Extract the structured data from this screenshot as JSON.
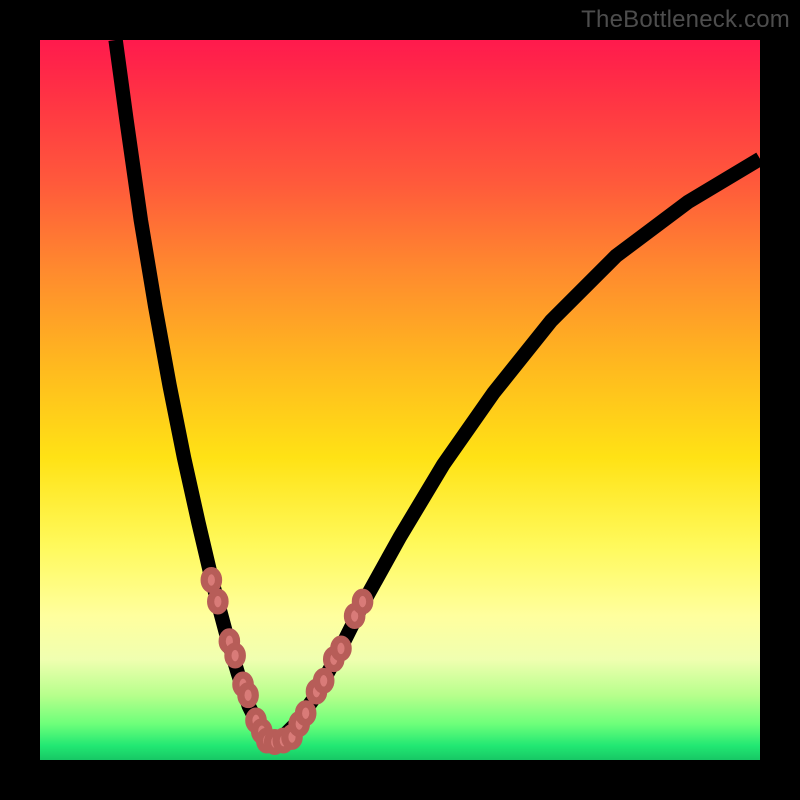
{
  "watermark": "TheBottleneck.com",
  "colors": {
    "frame_background": "#000000",
    "gradient_top": "#ff1a4d",
    "gradient_bottom": "#17c765",
    "curve_stroke": "#000000",
    "datapoint_fill": "#d97b78",
    "datapoint_stroke": "#b75d58",
    "watermark_text": "#4d4d4d"
  },
  "chart_data": {
    "type": "line",
    "title": "",
    "xlabel": "",
    "ylabel": "",
    "xlim": [
      0,
      100
    ],
    "ylim": [
      0,
      100
    ],
    "grid": false,
    "legend": false,
    "note": "Values are percentage coordinates within the plot area (0,0 = top-left, 100,100 = bottom-right). The chart depicts a V-shaped bottleneck curve with highlighted sample points near the valley.",
    "series": [
      {
        "name": "bottleneck-curve-left",
        "type": "line",
        "x": [
          10.5,
          12,
          14,
          16,
          18,
          20,
          22,
          24,
          26,
          27.5,
          29,
          30.5,
          31.8
        ],
        "y": [
          0,
          11,
          25,
          37,
          48,
          58,
          67,
          75.5,
          83,
          88,
          92.5,
          95.5,
          97.5
        ]
      },
      {
        "name": "bottleneck-curve-right",
        "type": "line",
        "x": [
          31.8,
          33.5,
          35.5,
          38,
          41,
          45,
          50,
          56,
          63,
          71,
          80,
          90,
          100
        ],
        "y": [
          97.5,
          97,
          95,
          91.5,
          86,
          78,
          69,
          59,
          49,
          39,
          30,
          22.5,
          16.5
        ]
      },
      {
        "name": "highlighted-points-left",
        "type": "scatter",
        "x": [
          23.8,
          24.7,
          26.3,
          27.1,
          28.2,
          28.9,
          30.0,
          30.8
        ],
        "y": [
          75.0,
          78.0,
          83.5,
          85.5,
          89.5,
          91.0,
          94.5,
          96.0
        ]
      },
      {
        "name": "highlighted-points-valley",
        "type": "scatter",
        "x": [
          31.5,
          32.6,
          33.8,
          35.0
        ],
        "y": [
          97.3,
          97.5,
          97.3,
          96.8
        ]
      },
      {
        "name": "highlighted-points-right",
        "type": "scatter",
        "x": [
          36.0,
          36.9,
          38.4,
          39.4,
          40.8,
          41.8,
          43.7,
          44.8
        ],
        "y": [
          95.0,
          93.5,
          90.5,
          89.0,
          86.0,
          84.5,
          80.0,
          78.0
        ]
      }
    ]
  }
}
